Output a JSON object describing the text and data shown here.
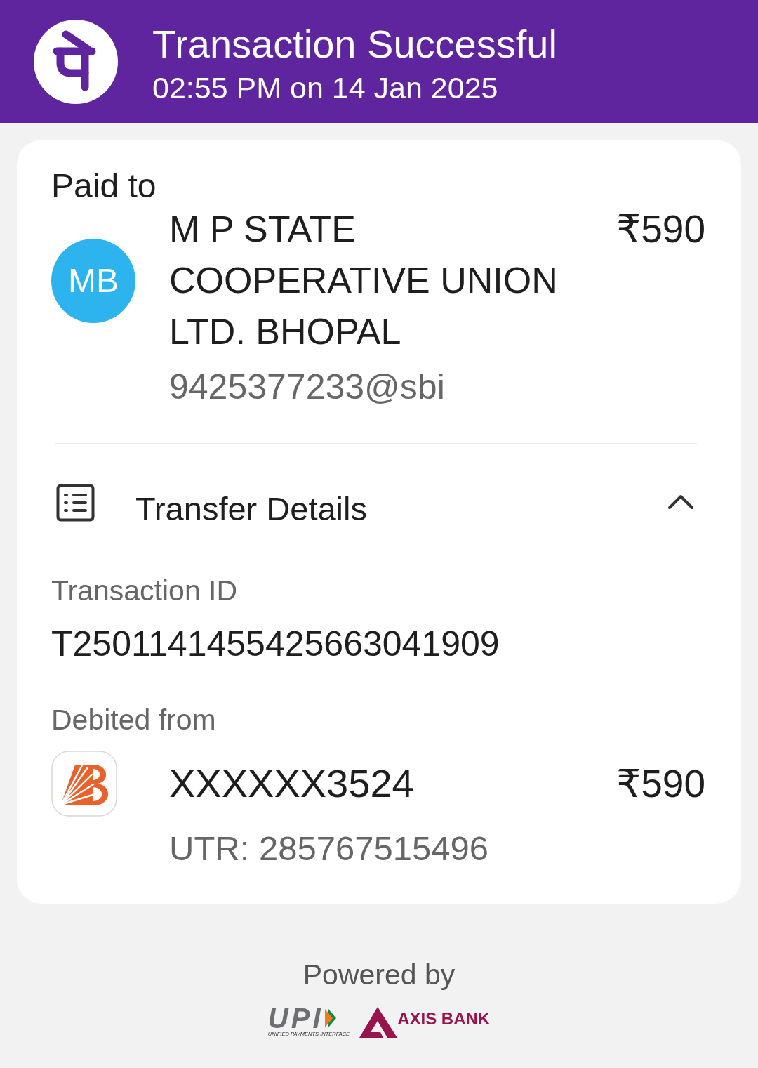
{
  "header": {
    "title": "Transaction Successful",
    "subtitle": "02:55 PM on 14 Jan 2025"
  },
  "paid_to": {
    "label": "Paid to",
    "avatar_initials": "MB",
    "name": "M P STATE COOPERATIVE UNION LTD. BHOPAL",
    "amount": "₹590",
    "upi_id": "9425377233@sbi"
  },
  "transfer_details": {
    "title": "Transfer Details",
    "expanded": true,
    "transaction_id": {
      "label": "Transaction ID",
      "value": "T2501141455425663041909"
    },
    "debited_from": {
      "label": "Debited from",
      "account": "XXXXXX3524",
      "amount": "₹590",
      "utr": "UTR: 285767515496"
    }
  },
  "footer": {
    "powered_by": "Powered by",
    "upi_logo": {
      "text": "UPI",
      "tagline": "UNIFIED PAYMENTS INTERFACE"
    },
    "bank_logo": {
      "text": "AXIS BANK"
    }
  }
}
